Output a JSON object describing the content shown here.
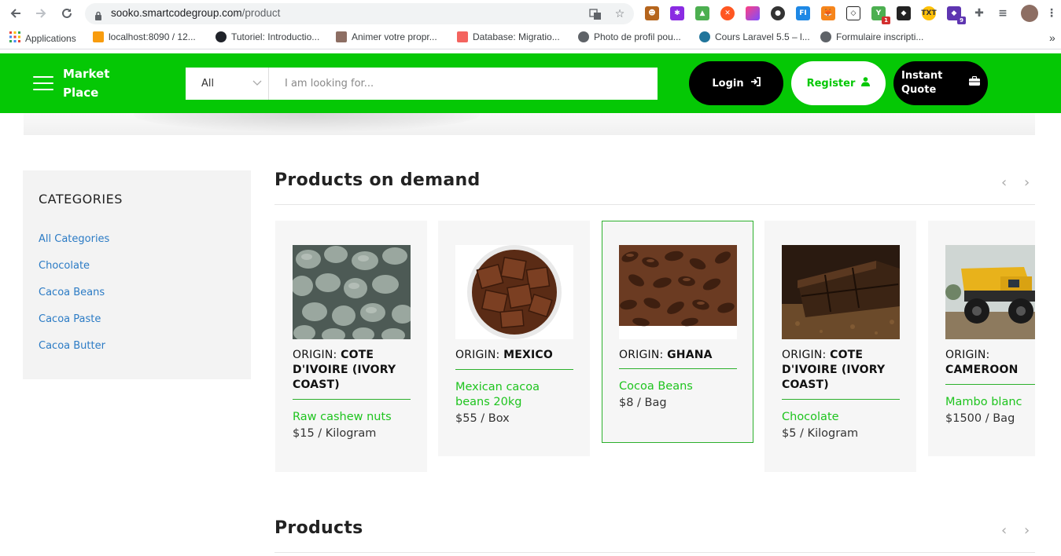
{
  "browser": {
    "url_host": "sooko.smartcodegroup.com",
    "url_path": "/product",
    "bookmarks": [
      {
        "label": "Applications",
        "icon": "apps-grid-icon"
      },
      {
        "label": "localhost:8090 / 12...",
        "icon": "phpmyadmin-icon"
      },
      {
        "label": "Tutoriel: Introductio...",
        "icon": "react-icon"
      },
      {
        "label": "Animer votre propr...",
        "icon": "bookmark-icon"
      },
      {
        "label": "Database: Migratio...",
        "icon": "laravel-icon"
      },
      {
        "label": "Photo de profil pou...",
        "icon": "globe-icon"
      },
      {
        "label": "Cours Laravel 5.5 – l...",
        "icon": "wordpress-icon"
      },
      {
        "label": "Formulaire inscripti...",
        "icon": "globe-icon"
      }
    ],
    "more_bookmarks": "»",
    "extension_badges": {
      "first": "1",
      "second": "9"
    }
  },
  "header": {
    "brand_line1": "Market",
    "brand_line2": "Place",
    "search_category": "All",
    "search_placeholder": "I am looking for...",
    "login_label": "Login",
    "register_label": "Register",
    "quote_line1": "Instant",
    "quote_line2": "Quote",
    "colors": {
      "brand_green": "#05c805",
      "dark": "#000000",
      "link_blue": "#2b7bc5",
      "product_green": "#1ec41e"
    }
  },
  "sidebar": {
    "title": "CATEGORIES",
    "items": [
      "All Categories",
      "Chocolate",
      "Cacoa Beans",
      "Cacoa Paste",
      "Cacoa Butter"
    ]
  },
  "sections": {
    "on_demand_title": "Products on demand",
    "products_title": "Products"
  },
  "products": [
    {
      "origin_label": "ORIGIN:",
      "origin": "COTE D'IVOIRE (IVORY COAST)",
      "name": "Raw cashew nuts",
      "price": "$15 / Kilogram"
    },
    {
      "origin_label": "ORIGIN:",
      "origin": "MEXICO",
      "name": "Mexican cacoa beans 20kg",
      "price": "$55 / Box"
    },
    {
      "origin_label": "ORIGIN:",
      "origin": "GHANA",
      "name": "Cocoa Beans",
      "price": "$8 / Bag"
    },
    {
      "origin_label": "ORIGIN:",
      "origin": "COTE D'IVOIRE (IVORY COAST)",
      "name": "Chocolate",
      "price": "$5 / Kilogram"
    },
    {
      "origin_label": "ORIGIN:",
      "origin": "CAMEROON",
      "name": "Mambo blanc",
      "price": "$1500 / Bag"
    }
  ]
}
